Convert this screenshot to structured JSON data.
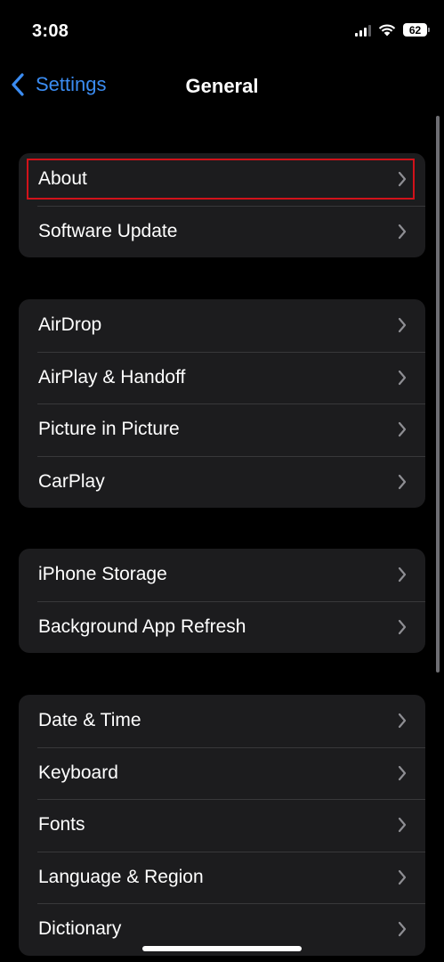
{
  "status_bar": {
    "time": "3:08",
    "battery_level": "62",
    "icons": [
      "cellular-signal-icon",
      "wifi-icon",
      "battery-icon"
    ]
  },
  "nav": {
    "back_label": "Settings",
    "title": "General",
    "accent_color": "#3b8cf2"
  },
  "groups": [
    {
      "items": [
        {
          "label": "About",
          "highlighted": true
        },
        {
          "label": "Software Update"
        }
      ]
    },
    {
      "items": [
        {
          "label": "AirDrop"
        },
        {
          "label": "AirPlay & Handoff"
        },
        {
          "label": "Picture in Picture"
        },
        {
          "label": "CarPlay"
        }
      ]
    },
    {
      "items": [
        {
          "label": "iPhone Storage"
        },
        {
          "label": "Background App Refresh"
        }
      ]
    },
    {
      "items": [
        {
          "label": "Date & Time"
        },
        {
          "label": "Keyboard"
        },
        {
          "label": "Fonts"
        },
        {
          "label": "Language & Region"
        },
        {
          "label": "Dictionary"
        }
      ]
    }
  ],
  "theme": {
    "background": "#000000",
    "cell_background": "#1c1c1e",
    "separator": "#38383a",
    "chevron": "#8e8e93",
    "highlight_border": "#d1121a"
  }
}
